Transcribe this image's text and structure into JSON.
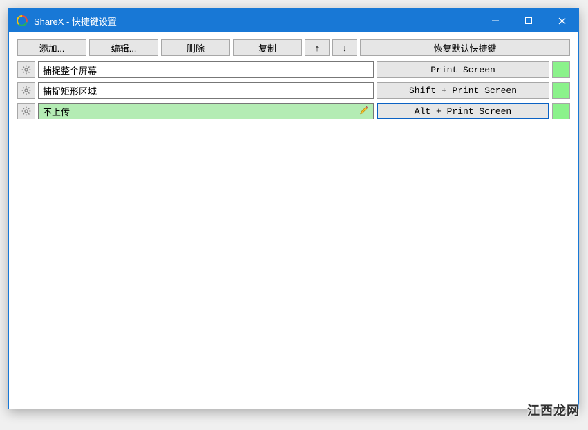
{
  "window": {
    "title": "ShareX - 快捷键设置"
  },
  "toolbar": {
    "add": "添加...",
    "edit": "编辑...",
    "delete": "删除",
    "duplicate": "复制",
    "up": "↑",
    "down": "↓",
    "restore": "恢复默认快捷键"
  },
  "rows": [
    {
      "name": "捕捉整个屏幕",
      "hotkey": "Print Screen",
      "editing": false
    },
    {
      "name": "捕捉矩形区域",
      "hotkey": "Shift + Print Screen",
      "editing": false
    },
    {
      "name": "不上传",
      "hotkey": "Alt + Print Screen",
      "editing": true
    }
  ],
  "watermark": "江西龙网"
}
